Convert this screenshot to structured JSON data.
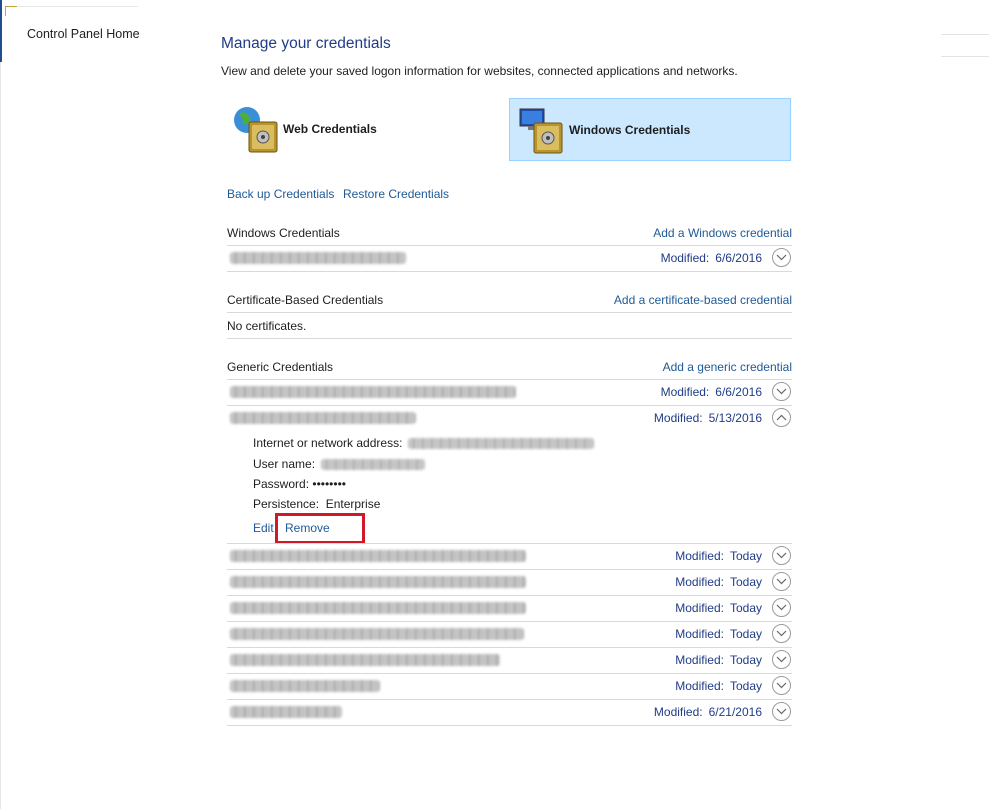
{
  "sidebar": {
    "home_label": "Control Panel Home"
  },
  "header": {
    "title": "Manage your credentials",
    "subtitle": "View and delete your saved logon information for websites, connected applications and networks."
  },
  "tiles": {
    "web": {
      "label": "Web Credentials",
      "icon": "web-credentials-vault-icon"
    },
    "windows": {
      "label": "Windows Credentials",
      "icon": "windows-credentials-vault-icon",
      "selected": true
    }
  },
  "actions": {
    "backup": "Back up Credentials",
    "restore": "Restore Credentials"
  },
  "sections": {
    "windows": {
      "title": "Windows Credentials",
      "add": "Add a Windows credential",
      "rows": [
        {
          "modified_label": "Modified:",
          "modified": "6/6/2016"
        }
      ]
    },
    "certificate": {
      "title": "Certificate-Based Credentials",
      "add": "Add a certificate-based credential",
      "empty": "No certificates."
    },
    "generic": {
      "title": "Generic Credentials",
      "add": "Add a generic credential",
      "rows": [
        {
          "modified_label": "Modified:",
          "modified": "6/6/2016"
        },
        {
          "modified_label": "Modified:",
          "modified": "5/13/2016",
          "expanded": true
        },
        {
          "modified_label": "Modified:",
          "modified": "Today"
        },
        {
          "modified_label": "Modified:",
          "modified": "Today"
        },
        {
          "modified_label": "Modified:",
          "modified": "Today"
        },
        {
          "modified_label": "Modified:",
          "modified": "Today"
        },
        {
          "modified_label": "Modified:",
          "modified": "Today"
        },
        {
          "modified_label": "Modified:",
          "modified": "Today"
        },
        {
          "modified_label": "Modified:",
          "modified": "6/21/2016"
        }
      ],
      "detail": {
        "address_label": "Internet or network address:",
        "username_label": "User name:",
        "password_label": "Password:",
        "password_value": "••••••••",
        "persistence_label": "Persistence:",
        "persistence_value": "Enterprise",
        "edit": "Edit",
        "remove": "Remove"
      }
    }
  },
  "colors": {
    "link": "#1f5a96",
    "title": "#1f3c88",
    "selected_tile": "#cce8ff",
    "highlight": "#d01a2a"
  }
}
